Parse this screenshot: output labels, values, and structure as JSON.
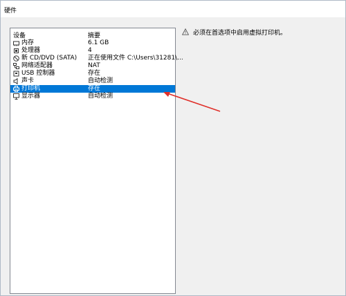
{
  "window": {
    "title": "硬件"
  },
  "device_list": {
    "headers": {
      "device": "设备",
      "summary": "摘要"
    },
    "rows": [
      {
        "name": "内存",
        "summary": "6.1 GB",
        "icon": "memory-icon"
      },
      {
        "name": "处理器",
        "summary": "4",
        "icon": "cpu-icon"
      },
      {
        "name": "新 CD/DVD (SATA)",
        "summary": "正在使用文件 C:\\Users\\31281\\...",
        "icon": "cd-icon"
      },
      {
        "name": "网络适配器",
        "summary": "NAT",
        "icon": "network-icon"
      },
      {
        "name": "USB 控制器",
        "summary": "存在",
        "icon": "usb-icon"
      },
      {
        "name": "声卡",
        "summary": "自动检测",
        "icon": "speaker-icon"
      },
      {
        "name": "打印机",
        "summary": "存在",
        "icon": "printer-icon",
        "selected": true
      },
      {
        "name": "显示器",
        "summary": "自动检测",
        "icon": "monitor-icon"
      }
    ]
  },
  "right_panel": {
    "warning_text": "必须在首选项中启用虚拟打印机。",
    "icon": "warning-icon"
  },
  "colors": {
    "selection": "#0078d7",
    "arrow": "#e0302a"
  }
}
